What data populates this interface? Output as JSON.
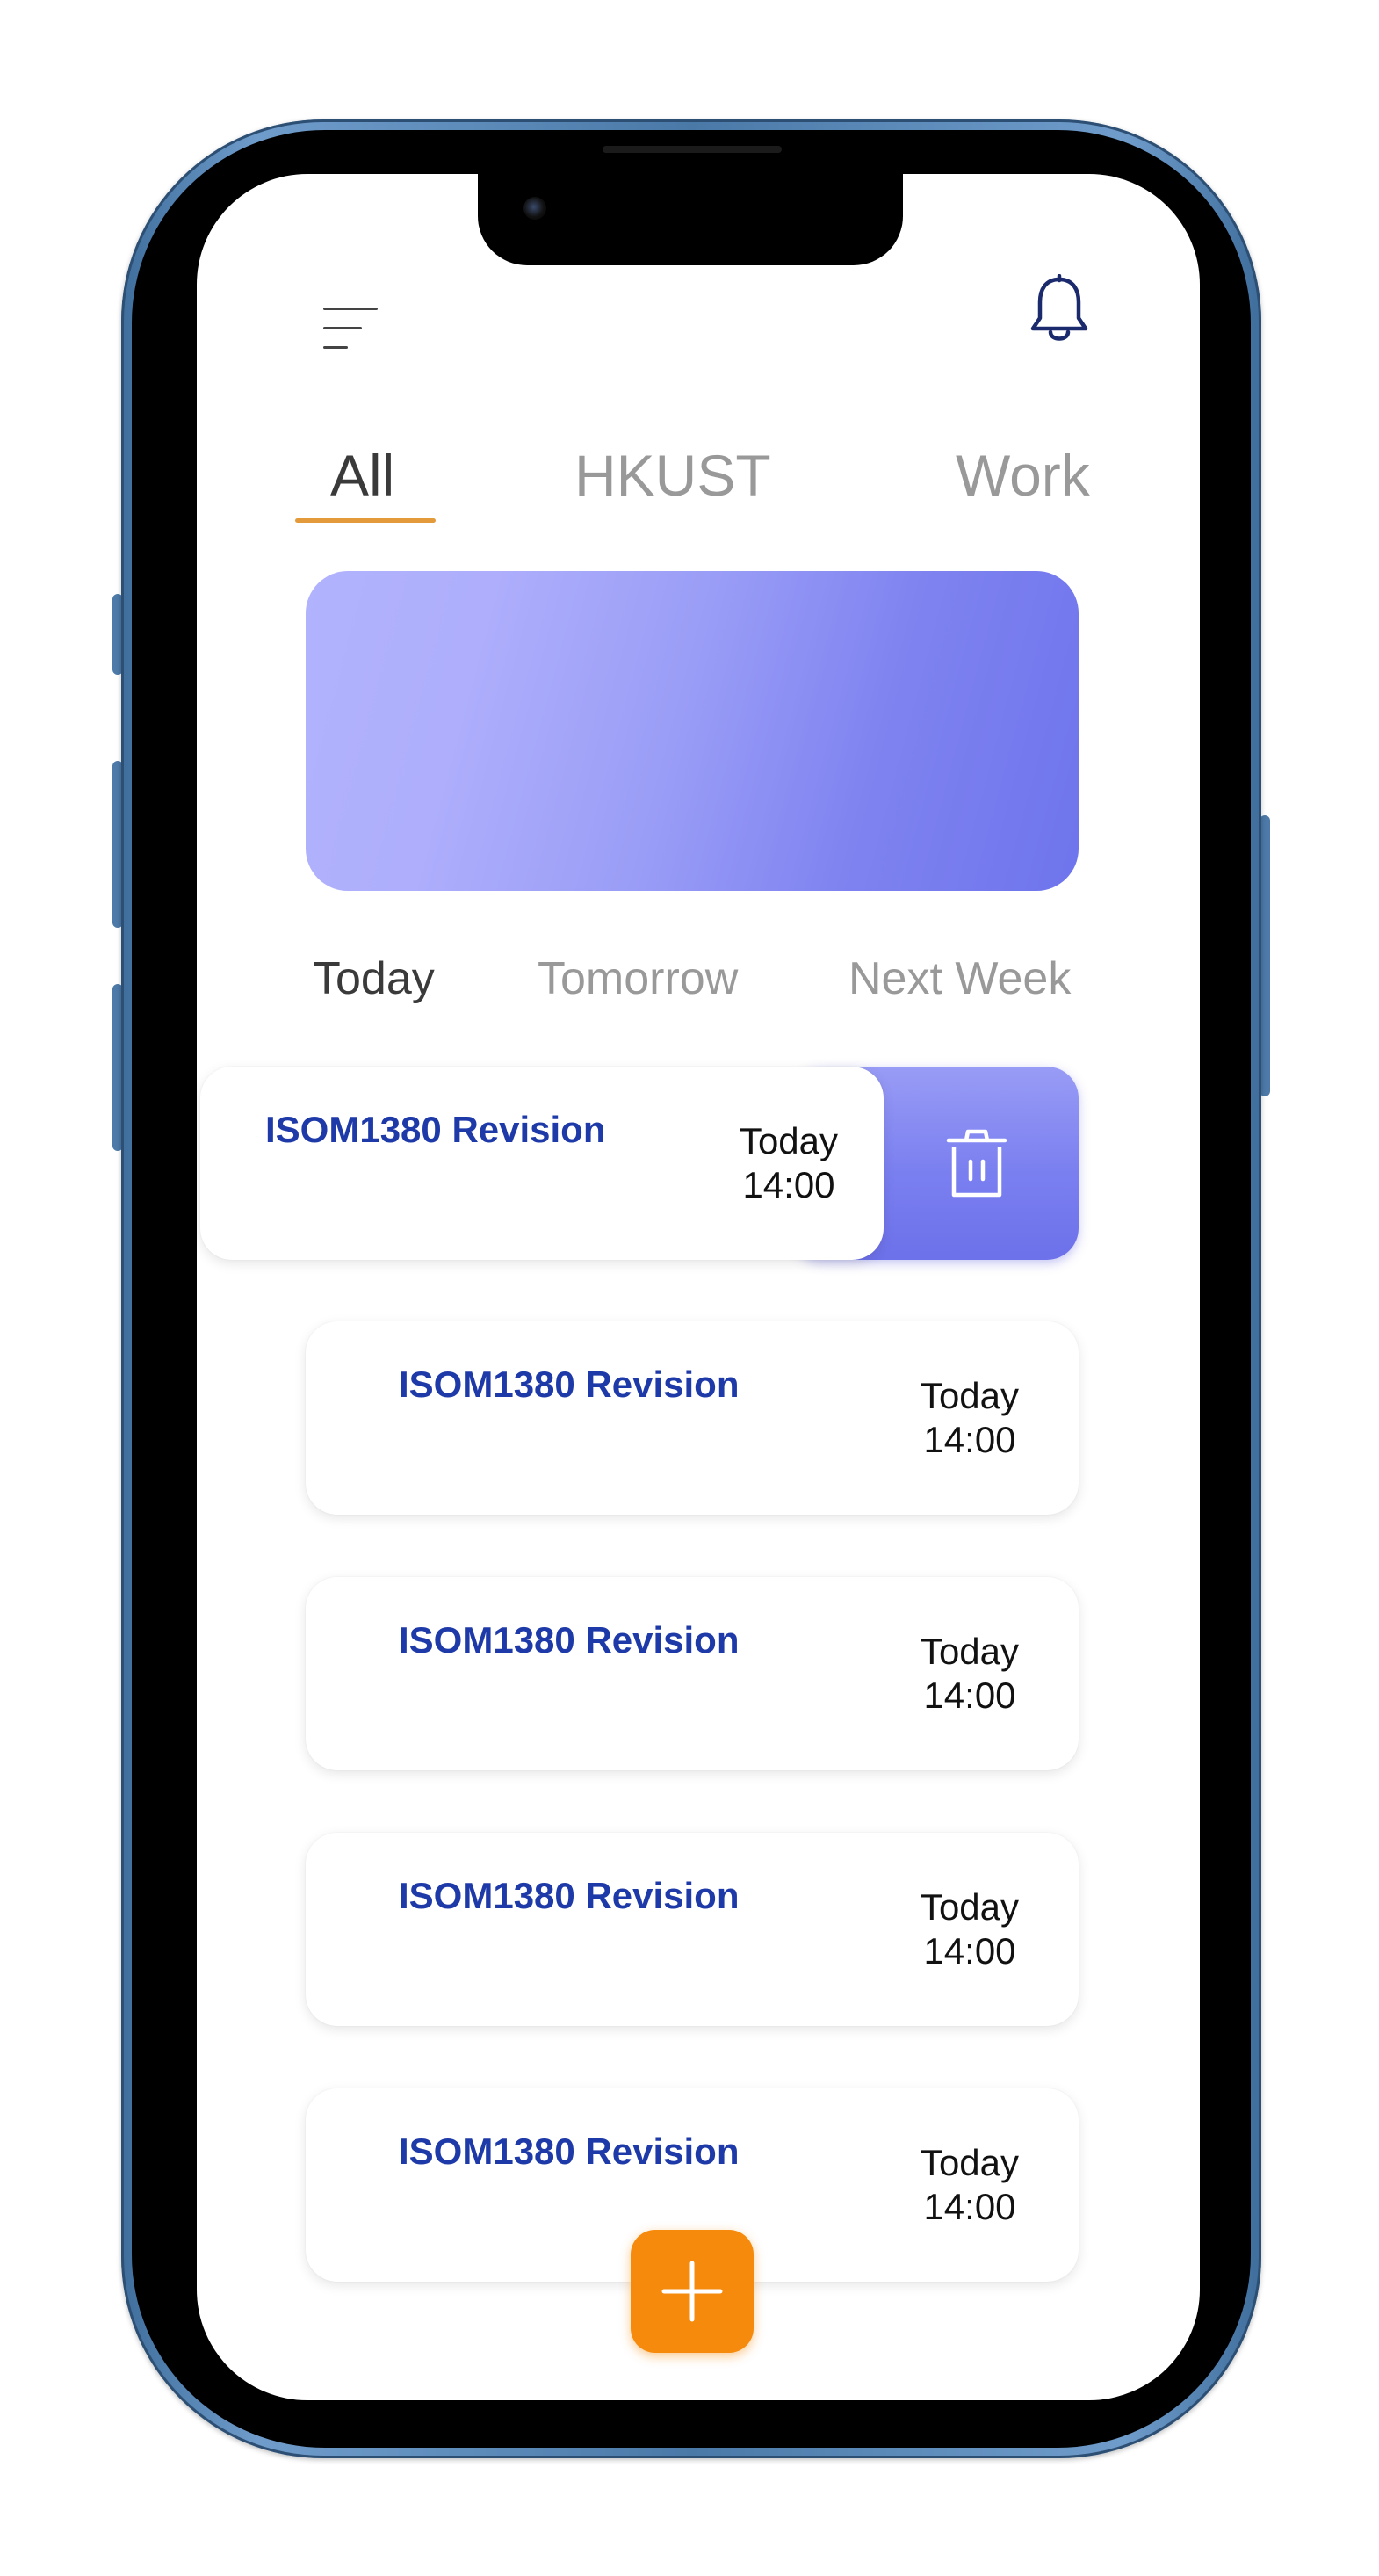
{
  "tabs": [
    {
      "label": "All",
      "active": true
    },
    {
      "label": "HKUST",
      "active": false
    },
    {
      "label": "Work",
      "active": false
    }
  ],
  "date_filters": [
    {
      "label": "Today",
      "active": true
    },
    {
      "label": "Tomorrow",
      "active": false
    },
    {
      "label": "Next Week",
      "active": false
    }
  ],
  "tasks": [
    {
      "title": "ISOM1380 Revision",
      "day": "Today",
      "time": "14:00"
    },
    {
      "title": "ISOM1380 Revision",
      "day": "Today",
      "time": "14:00"
    },
    {
      "title": "ISOM1380 Revision",
      "day": "Today",
      "time": "14:00"
    },
    {
      "title": "ISOM1380 Revision",
      "day": "Today",
      "time": "14:00"
    },
    {
      "title": "ISOM1380 Revision",
      "day": "Today",
      "time": "14:00"
    }
  ],
  "icons": {
    "menu": "menu-icon",
    "notifications": "bell-icon",
    "delete": "trash-icon",
    "add": "plus-icon"
  },
  "colors": {
    "accent": "#f58a0c",
    "tab_underline": "#e39a3b",
    "task_title": "#1e3aa8",
    "banner_start": "#b1b3fd",
    "banner_end": "#6e74ec"
  }
}
